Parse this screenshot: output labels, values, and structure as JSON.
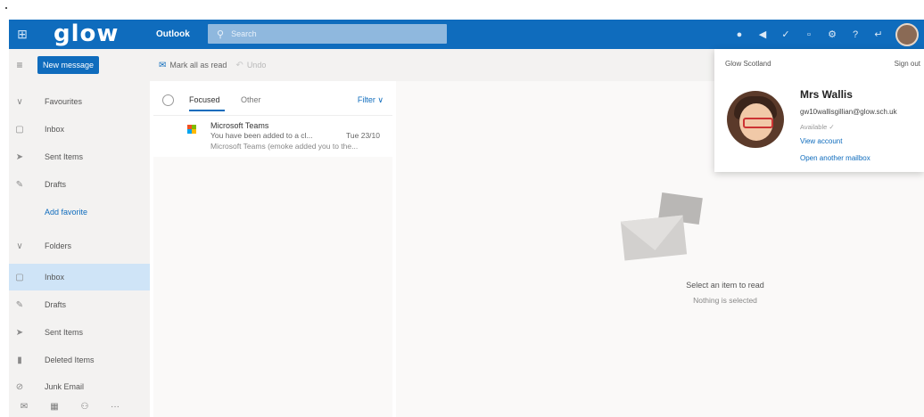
{
  "topbar": {
    "logo": "glow",
    "app_name": "Outlook",
    "search_placeholder": "Search",
    "icons": [
      "skype-icon",
      "megaphone-icon",
      "todo-icon",
      "chat-icon",
      "settings-icon",
      "help-icon",
      "feedback-icon",
      "avatar"
    ]
  },
  "sidebar": {
    "new_message": "New message",
    "items": [
      {
        "label": "Favourites",
        "icon": "chevron-down-icon"
      },
      {
        "label": "Inbox",
        "icon": "inbox-icon"
      },
      {
        "label": "Sent Items",
        "icon": "send-icon"
      },
      {
        "label": "Drafts",
        "icon": "pencil-icon"
      },
      {
        "label": "Add favorite",
        "icon": ""
      },
      {
        "label": "Folders",
        "icon": "chevron-down-icon"
      },
      {
        "label": "Inbox",
        "icon": "inbox-icon",
        "selected": true
      },
      {
        "label": "Drafts",
        "icon": "pencil-icon"
      },
      {
        "label": "Sent Items",
        "icon": "send-icon"
      },
      {
        "label": "Deleted Items",
        "icon": "trash-icon"
      },
      {
        "label": "Junk Email",
        "icon": "junk-icon"
      }
    ],
    "bottom_icons": [
      "mail-icon",
      "calendar-icon",
      "people-icon",
      "more-icon"
    ]
  },
  "toolbar": {
    "mark_all_read": "Mark all as read",
    "undo": "Undo"
  },
  "message_list": {
    "tab_focused": "Focused",
    "tab_other": "Other",
    "filter": "Filter",
    "messages": [
      {
        "sender": "Microsoft Teams",
        "subject": "You have been added to a cl...",
        "date": "Tue 23/10",
        "preview": "Microsoft Teams (emoke added you to the..."
      }
    ]
  },
  "reading_pane": {
    "title": "Select an item to read",
    "subtitle": "Nothing is selected"
  },
  "account": {
    "org": "Glow Scotland",
    "sign_out": "Sign out",
    "name": "Mrs Wallis",
    "email": "gw10wallisgillian@glow.sch.uk",
    "status": "Available ✓",
    "view_account": "View account",
    "open_mailbox": "Open another mailbox"
  },
  "colors": {
    "brand_blue": "#0f6cbd",
    "selected_bg": "#cfe4f7"
  }
}
